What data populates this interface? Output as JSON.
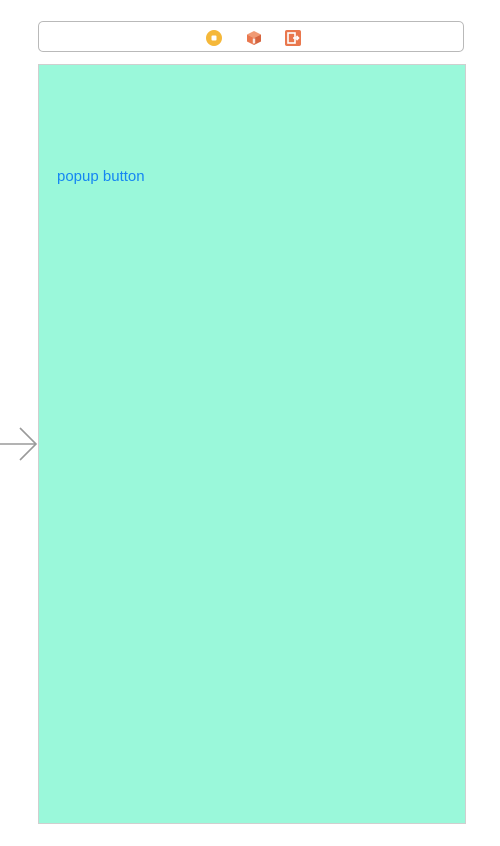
{
  "colors": {
    "view_background": "#9af8da",
    "button_text": "#1586f2",
    "controller_icon": "#f5b83a",
    "first_responder_icon": "#e9774d",
    "exit_icon": "#e9774d"
  },
  "scene_dock": {
    "icons": [
      "view-controller-icon",
      "first-responder-icon",
      "exit-icon"
    ]
  },
  "view": {
    "button_label": "popup button"
  }
}
